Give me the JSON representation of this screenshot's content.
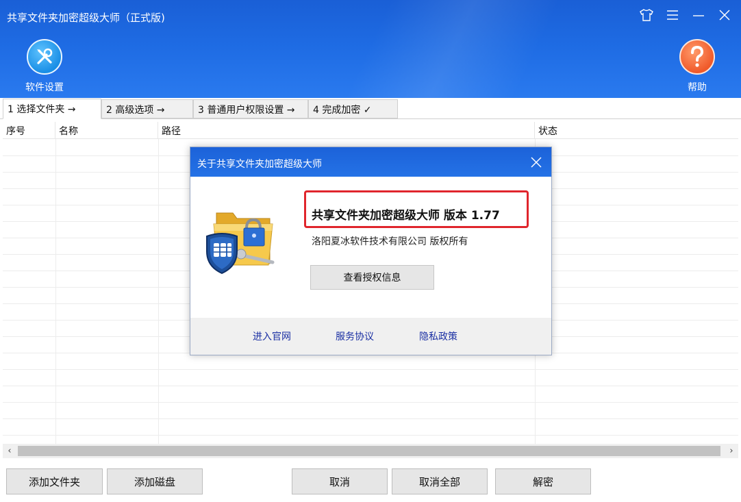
{
  "window": {
    "title": "共享文件夹加密超级大师（正式版)",
    "controls": [
      "shirt-icon",
      "menu-icon",
      "minimize-icon",
      "close-icon"
    ]
  },
  "toolbar": {
    "settings_label": "软件设置",
    "help_label": "帮助"
  },
  "tabs": [
    {
      "label": "1 选择文件夹 →"
    },
    {
      "label": "2 高级选项 →"
    },
    {
      "label": "3 普通用户权限设置 →"
    },
    {
      "label": "4 完成加密 ✓"
    }
  ],
  "table": {
    "columns": [
      "序号",
      "名称",
      "路径",
      "状态"
    ]
  },
  "buttons": {
    "add_folder": "添加文件夹",
    "add_disk": "添加磁盘",
    "cancel": "取消",
    "cancel_all": "取消全部",
    "decrypt": "解密"
  },
  "dialog": {
    "title": "关于共享文件夹加密超级大师",
    "version_text": "共享文件夹加密超级大师 版本 1.77",
    "copyright": "洛阳夏冰软件技术有限公司 版权所有",
    "license_button": "查看授权信息",
    "links": [
      "进入官网",
      "服务协议",
      "隐私政策"
    ]
  },
  "colors": {
    "header_blue": "#1e6be3",
    "highlight_red": "#e0252c",
    "link_blue": "#1a2fa3"
  }
}
